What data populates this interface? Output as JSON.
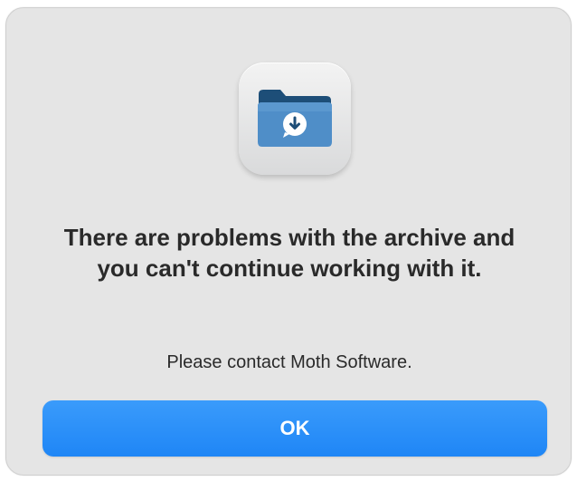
{
  "dialog": {
    "icon": "archive-folder-download-icon",
    "title": "There are problems with the archive and you can't continue working with it.",
    "message": "Please contact Moth Software.",
    "ok_label": "OK"
  },
  "colors": {
    "dialog_background": "#e5e5e5",
    "button_blue": "#1f86f6",
    "text": "#2a2a2a",
    "folder_dark": "#1d4e78",
    "folder_light": "#4f8ec8"
  }
}
